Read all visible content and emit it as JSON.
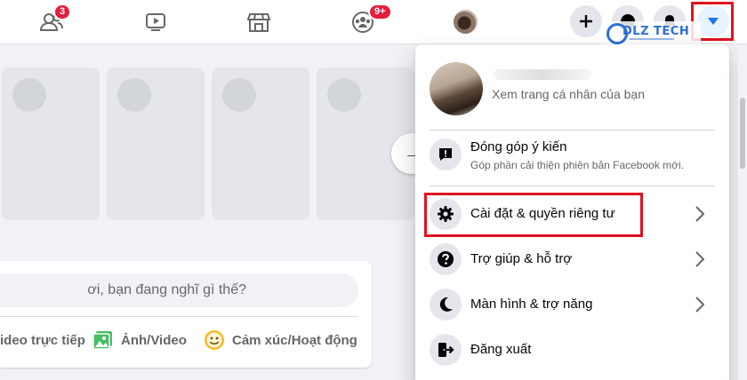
{
  "nav": {
    "friends_badge": "3",
    "groups_badge": "9+"
  },
  "composer": {
    "placeholder": "ơi, bạn đang nghĩ gì thế?",
    "live_label": "ideo trực tiếp",
    "photo_label": "Ảnh/Video",
    "feeling_label": "Cảm xúc/Hoạt động"
  },
  "menu": {
    "profile": {
      "subtitle": "Xem trang cá nhân của bạn"
    },
    "feedback": {
      "label": "Đóng góp ý kiến",
      "description": "Góp phần cải thiện phiên bản Facebook mới."
    },
    "items": [
      {
        "label": "Cài đặt & quyền riêng tư",
        "icon": "gear-icon"
      },
      {
        "label": "Trợ giúp & hỗ trợ",
        "icon": "question-icon"
      },
      {
        "label": "Màn hình & trợ năng",
        "icon": "moon-icon"
      },
      {
        "label": "Đăng xuất",
        "icon": "logout-icon"
      }
    ]
  },
  "watermark": {
    "text": "DLZ TECH"
  },
  "colors": {
    "highlight": "#e0121f",
    "badge": "#e41e3f",
    "accent": "#1877f2"
  }
}
